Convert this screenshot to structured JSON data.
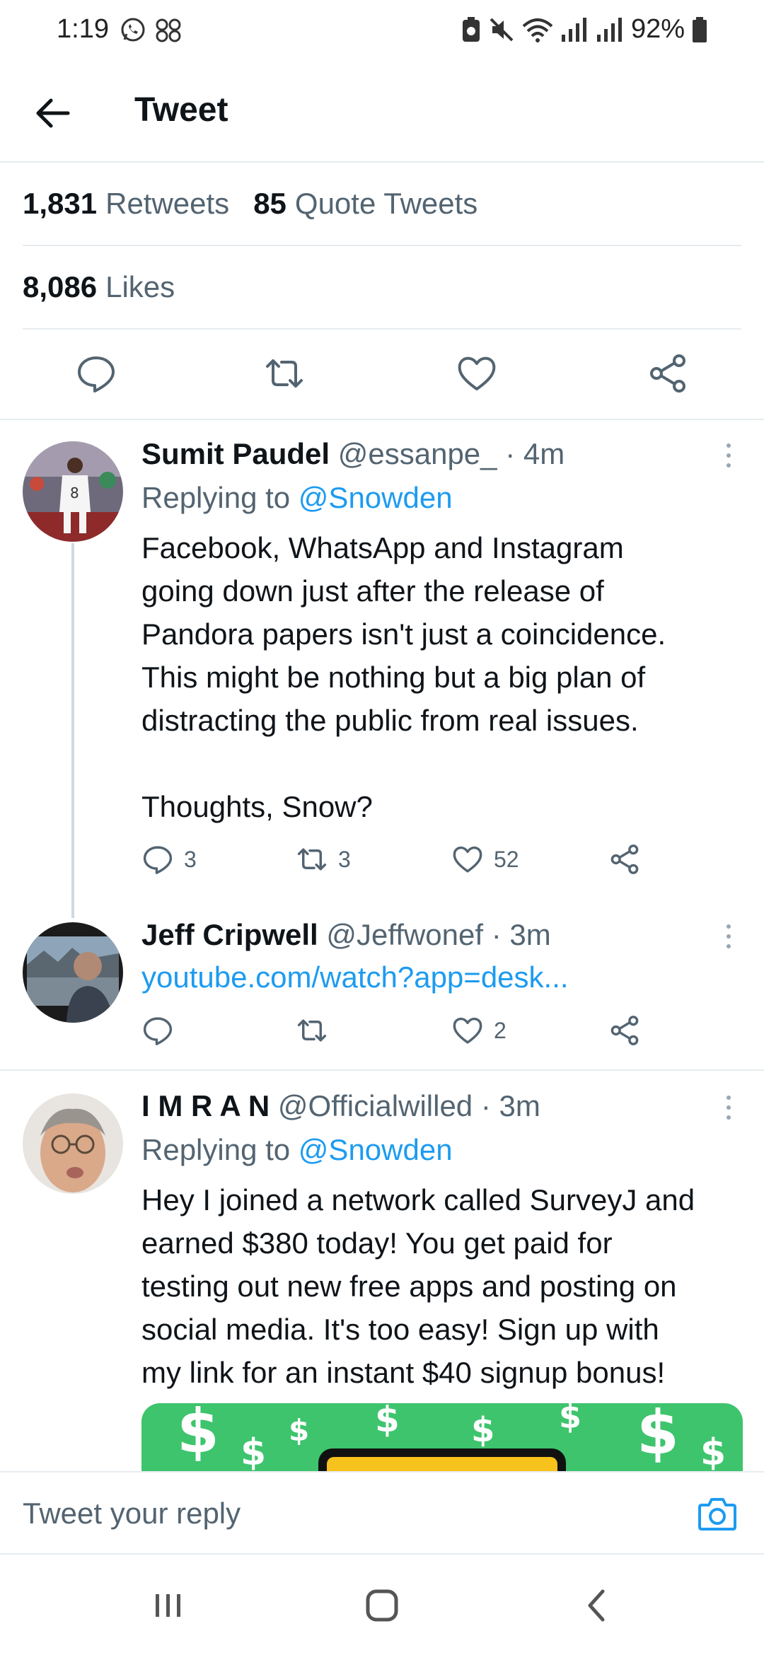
{
  "status_bar": {
    "time": "1:19",
    "battery": "92%"
  },
  "app_bar": {
    "title": "Tweet"
  },
  "stats": {
    "retweets_count": "1,831",
    "retweets_label": "Retweets",
    "quotes_count": "85",
    "quotes_label": "Quote Tweets",
    "likes_count": "8,086",
    "likes_label": "Likes"
  },
  "replies": [
    {
      "name": "Sumit Paudel",
      "handle": "@essanpe_ · 4m",
      "replying_prefix": "Replying to",
      "replying_to": "@Snowden",
      "text": "Facebook, WhatsApp and Instagram\ngoing down just after the release of\nPandora papers isn't just a coincidence.\nThis might be nothing but a big plan of\ndistracting the public from real issues.\n\nThoughts, Snow?",
      "reply_count": "3",
      "retweet_count": "3",
      "like_count": "52"
    },
    {
      "name": "Jeff Cripwell",
      "handle": "@Jeffwonef · 3m",
      "link": "youtube.com/watch?app=desk...",
      "like_count": "2"
    },
    {
      "name": "I M R A N",
      "handle": "@Officialwilled · 3m",
      "replying_prefix": "Replying to",
      "replying_to": "@Snowden",
      "text": "Hey I joined a network called SurveyJ and\nearned $380 today! You get paid for\ntesting out new free apps and posting on\nsocial media. It's too easy! Sign up with\nmy link for an instant $40 signup bonus!"
    }
  ],
  "reply_bar": {
    "placeholder": "Tweet your reply"
  },
  "colors": {
    "accent": "#1d9bf0",
    "secondary_text": "#536471",
    "divider": "#e6ecf0",
    "promo_green": "#3ec46d"
  }
}
